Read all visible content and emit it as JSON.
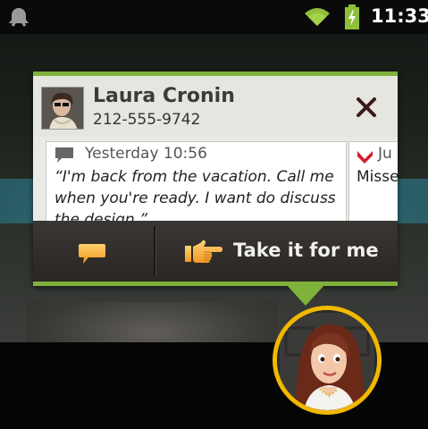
{
  "status_bar": {
    "time": "11:33",
    "icons": [
      "notification-icon",
      "wifi-icon",
      "battery-charging-icon"
    ]
  },
  "popup": {
    "contact": {
      "name": "Laura Cronin",
      "phone": "212-555-9742"
    },
    "messages": [
      {
        "icon": "chat-bubble-icon",
        "time": "Yesterday 10:56",
        "text": "“I'm back from the vacation. Call me when you're ready. I want do discuss the design.”"
      },
      {
        "icon": "missed-call-icon",
        "time": "Ju",
        "text": "Misse"
      }
    ],
    "actions": {
      "reply_icon": "speech-bubble-icon",
      "take_icon": "pointing-hand-icon",
      "take_label": "Take it for me"
    }
  },
  "colors": {
    "accent_green": "#7fb23a",
    "badge_gold": "#f0b800",
    "action_bar": "#2f2b28"
  }
}
